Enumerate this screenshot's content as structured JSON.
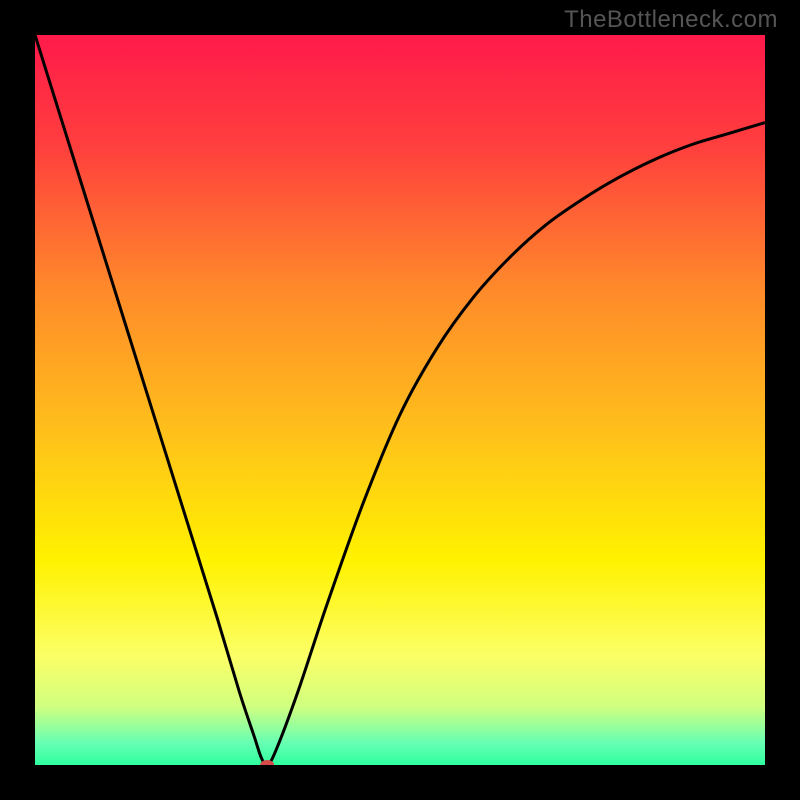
{
  "watermark": "TheBottleneck.com",
  "chart_data": {
    "type": "line",
    "title": "",
    "xlabel": "",
    "ylabel": "",
    "xlim": [
      0,
      100
    ],
    "ylim": [
      0,
      100
    ],
    "background": {
      "type": "vertical-gradient",
      "stops": [
        {
          "offset": 0,
          "color": "#ff1a4a"
        },
        {
          "offset": 15,
          "color": "#ff3e3e"
        },
        {
          "offset": 35,
          "color": "#ff8a2a"
        },
        {
          "offset": 55,
          "color": "#ffc21a"
        },
        {
          "offset": 72,
          "color": "#fff200"
        },
        {
          "offset": 85,
          "color": "#fcff66"
        },
        {
          "offset": 92,
          "color": "#d0ff80"
        },
        {
          "offset": 97,
          "color": "#66ffb3"
        },
        {
          "offset": 100,
          "color": "#2eff9e"
        }
      ]
    },
    "series": [
      {
        "name": "bottleneck-curve",
        "x": [
          0,
          5,
          10,
          15,
          20,
          25,
          28,
          30,
          31,
          31.8,
          33,
          36,
          40,
          45,
          50,
          55,
          60,
          65,
          70,
          75,
          80,
          85,
          90,
          95,
          100
        ],
        "y": [
          100,
          84,
          68,
          52,
          36,
          20,
          10,
          4,
          1,
          0,
          2,
          10,
          22,
          36,
          48,
          57,
          64,
          69.5,
          74,
          77.5,
          80.5,
          83,
          85,
          86.5,
          88
        ]
      }
    ],
    "marker": {
      "name": "minimum-point",
      "x": 31.8,
      "y": 0,
      "color": "#d64a4a",
      "rx": 7,
      "ry": 5
    }
  }
}
